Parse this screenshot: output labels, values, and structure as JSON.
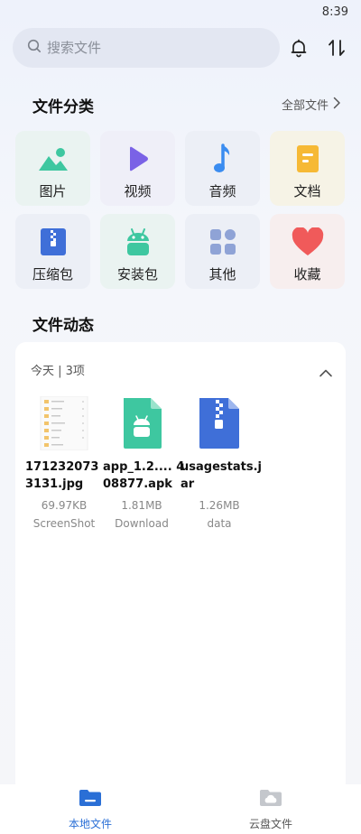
{
  "status": {
    "time": "8:39"
  },
  "search": {
    "placeholder": "搜索文件"
  },
  "header_icons": {
    "notification": "bell-icon",
    "sort": "sort-arrows-icon"
  },
  "categories_section": {
    "title": "文件分类",
    "all_files_label": "全部文件",
    "items": [
      {
        "label": "图片",
        "icon": "image-icon",
        "color": "#3ec7a0"
      },
      {
        "label": "视频",
        "icon": "play-icon",
        "color": "#7a62e6"
      },
      {
        "label": "音频",
        "icon": "music-note-icon",
        "color": "#3a8cf0"
      },
      {
        "label": "文档",
        "icon": "document-icon",
        "color": "#f6b935"
      },
      {
        "label": "压缩包",
        "icon": "zip-icon",
        "color": "#3f6fd8"
      },
      {
        "label": "安装包",
        "icon": "android-icon",
        "color": "#3ec7a0"
      },
      {
        "label": "其他",
        "icon": "grid-icon",
        "color": "#8fa3d6"
      },
      {
        "label": "收藏",
        "icon": "heart-icon",
        "color": "#f05a5a"
      }
    ]
  },
  "activity_section": {
    "title": "文件动态",
    "day_label": "今天 | 3项",
    "files": [
      {
        "name": "1712320733131.jpg",
        "display_name": "171232073 3131.jpg",
        "size": "69.97KB",
        "source": "ScreenShot",
        "icon": "image-thumbnail"
      },
      {
        "name": "app_1.2....408877.apk",
        "display_name": "app_1.2.... 408877.apk",
        "size": "1.81MB",
        "source": "Download",
        "icon": "apk-file-icon"
      },
      {
        "name": "usagestats.jar",
        "display_name": "usagestats.j ar",
        "size": "1.26MB",
        "source": "data",
        "icon": "zip-file-icon"
      }
    ]
  },
  "bottom_nav": {
    "items": [
      {
        "label": "本地文件",
        "active": true,
        "color": "#2a6fd6"
      },
      {
        "label": "云盘文件",
        "active": false,
        "color": "#555555"
      }
    ]
  }
}
